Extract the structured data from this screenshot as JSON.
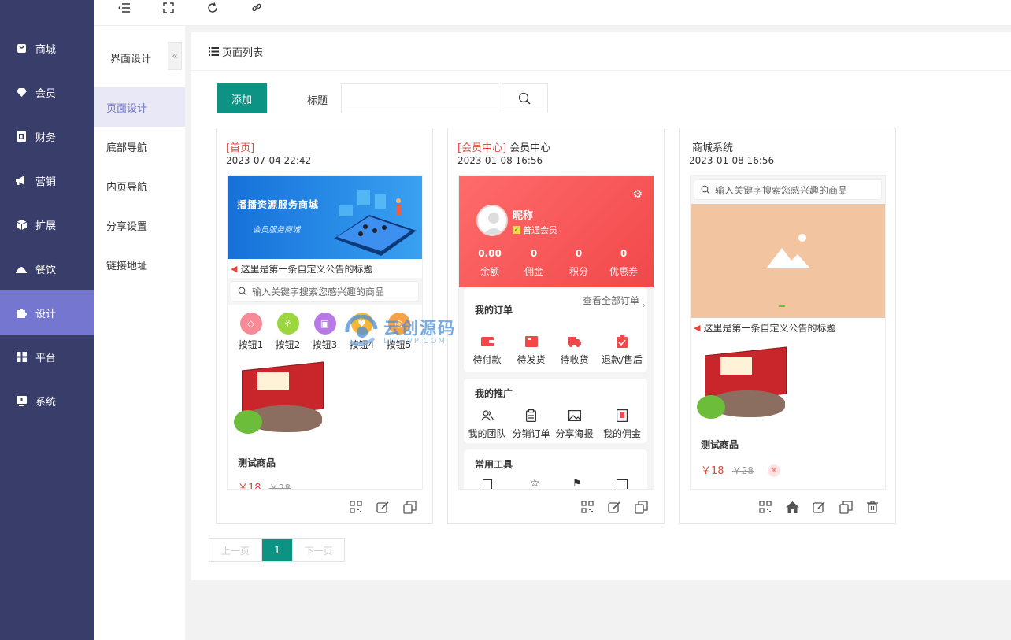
{
  "sidebar": {
    "items": [
      {
        "label": "商城",
        "icon": "bag-icon"
      },
      {
        "label": "会员",
        "icon": "gem-icon"
      },
      {
        "label": "财务",
        "icon": "wallet-icon"
      },
      {
        "label": "营销",
        "icon": "megaphone-icon"
      },
      {
        "label": "扩展",
        "icon": "cube-icon"
      },
      {
        "label": "餐饮",
        "icon": "dish-icon"
      },
      {
        "label": "设计",
        "icon": "puzzle-icon",
        "active": true
      },
      {
        "label": "平台",
        "icon": "grid-icon"
      },
      {
        "label": "系统",
        "icon": "monitor-icon"
      }
    ]
  },
  "topbar": {
    "icons": [
      "menu-fold-icon",
      "fullscreen-icon",
      "refresh-icon",
      "link-icon"
    ]
  },
  "subnav": {
    "title": "界面设计",
    "collapse": "«",
    "items": [
      {
        "label": "页面设计",
        "active": true
      },
      {
        "label": "底部导航"
      },
      {
        "label": "内页导航"
      },
      {
        "label": "分享设置"
      },
      {
        "label": "链接地址"
      }
    ]
  },
  "main": {
    "header": "页面列表",
    "add_label": "添加",
    "title_label": "标题",
    "title_value": "",
    "title_placeholder": ""
  },
  "cards": [
    {
      "tag": "[首页]",
      "name": "",
      "date": "2023-07-04 22:42",
      "banner_title": "播播资源服务商城",
      "banner_sub": "会员服务商城",
      "notice": "这里是第一条自定义公告的标题",
      "search_placeholder": "输入关键字搜索您感兴趣的商品",
      "buttons": [
        "按钮1",
        "按钮2",
        "按钮3",
        "按钮4",
        "按钮5"
      ],
      "product_name": "测试商品",
      "price": "￥18",
      "old_price": "￥28"
    },
    {
      "tag": "[会员中心]",
      "name": "会员中心",
      "date": "2023-01-08 16:56",
      "nickname": "昵称",
      "level": "普通会员",
      "stats": [
        {
          "value": "0.00",
          "label": "余额"
        },
        {
          "value": "0",
          "label": "佣金"
        },
        {
          "value": "0",
          "label": "积分"
        },
        {
          "value": "0",
          "label": "优惠券"
        }
      ],
      "orders_title": "我的订单",
      "orders_link": "查看全部订单",
      "order_items": [
        "待付款",
        "待发货",
        "待收货",
        "退款/售后"
      ],
      "promo_title": "我的推广",
      "promo_items": [
        "我的团队",
        "分销订单",
        "分享海报",
        "我的佣金"
      ],
      "tools_title": "常用工具"
    },
    {
      "tag": "",
      "name": "商城系统",
      "date": "2023-01-08 16:56",
      "search_placeholder": "输入关键字搜索您感兴趣的商品",
      "notice": "这里是第一条自定义公告的标题",
      "product_name": "测试商品",
      "price": "￥18",
      "old_price": "￥28"
    }
  ],
  "watermark": {
    "main": "云创源码",
    "sub": "LOOWP.COM"
  },
  "pager": {
    "prev": "上一页",
    "current": "1",
    "next": "下一页"
  },
  "colors": {
    "sidebar": "#393d69",
    "accent": "#7476d0",
    "primary": "#0d9384",
    "red": "#e8483c"
  }
}
